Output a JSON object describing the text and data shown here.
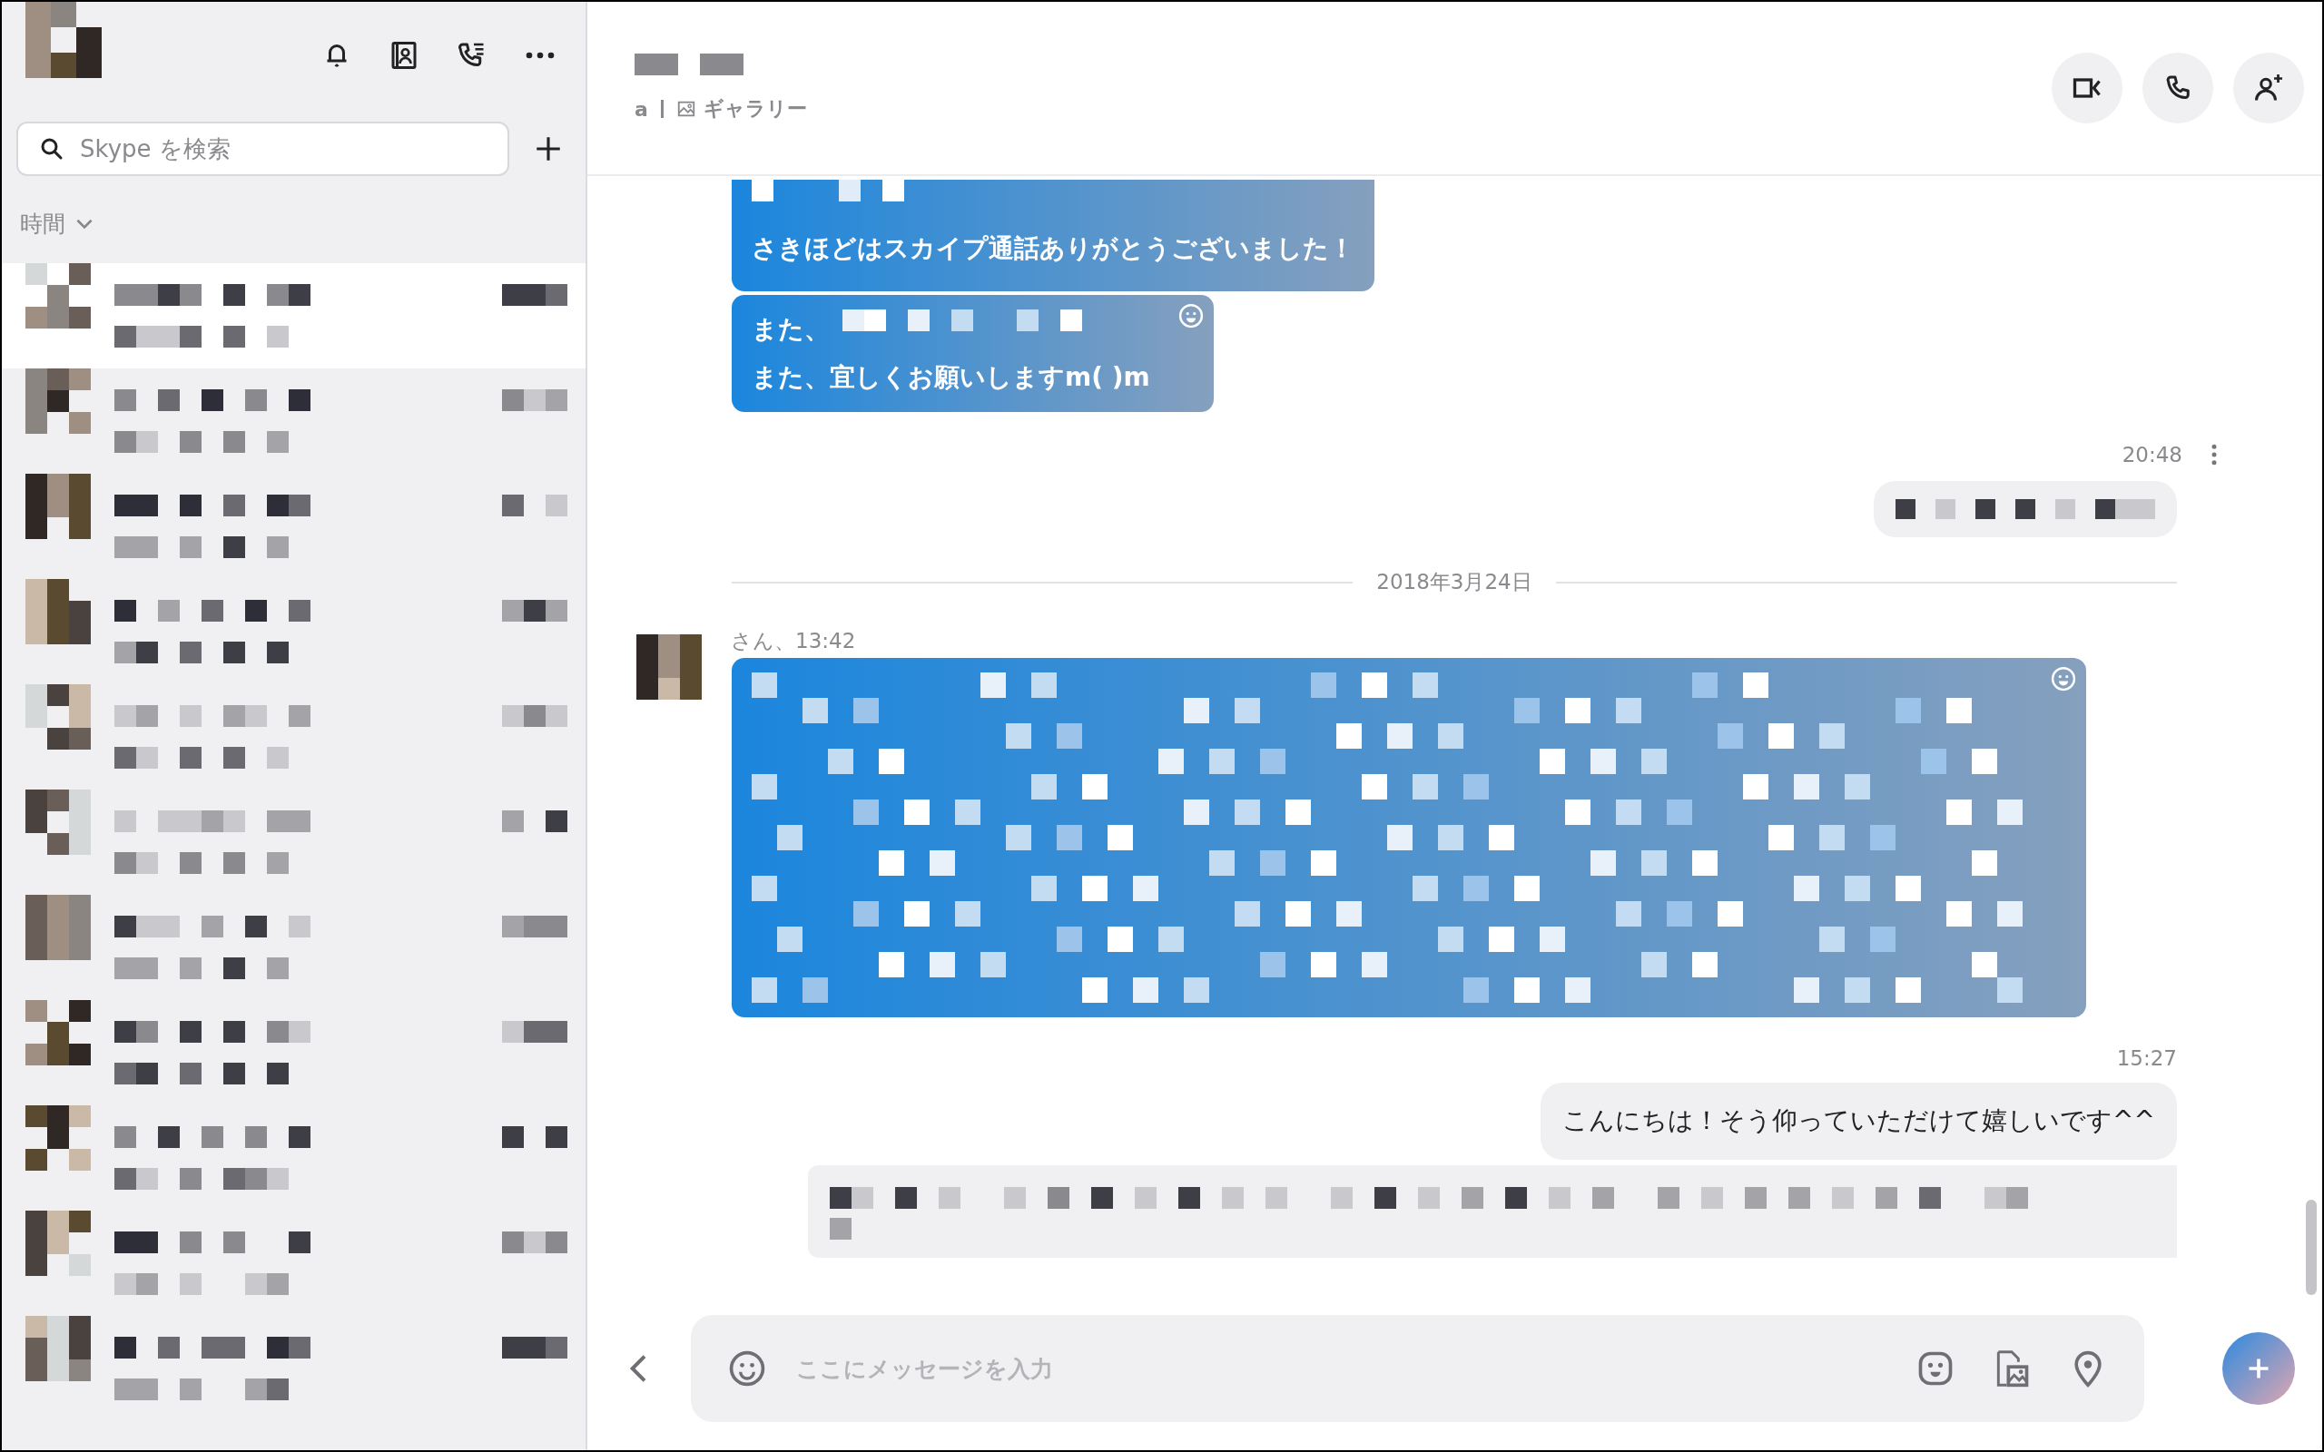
{
  "sidebar": {
    "search": {
      "placeholder": "Skype を検索"
    },
    "sort_label": "時間",
    "chats": [
      {
        "selected": true
      },
      {
        "selected": false
      },
      {
        "selected": false
      },
      {
        "selected": false
      },
      {
        "selected": false
      },
      {
        "selected": false
      },
      {
        "selected": false
      },
      {
        "selected": false
      },
      {
        "selected": false
      },
      {
        "selected": false
      },
      {
        "selected": false
      }
    ]
  },
  "chat": {
    "header": {
      "links": [
        "a",
        "ギャラリー"
      ]
    },
    "messages": [
      {
        "kind": "received",
        "redacted": true,
        "reaction": false,
        "lines": [
          {
            "text": "さきほどはスカイプ通話ありがとうございました！",
            "redacted": false
          }
        ]
      },
      {
        "kind": "received",
        "redacted": false,
        "reaction": true,
        "lines": [
          {
            "text": "また、",
            "redacted": true
          },
          {
            "text": "また、宜しくお願いしますm( )m",
            "redacted": false
          }
        ]
      },
      {
        "kind": "time",
        "text": "20:48",
        "menu": true
      },
      {
        "kind": "sent",
        "redacted": true,
        "reaction": false
      },
      {
        "kind": "date",
        "text": "2018年3月24日"
      },
      {
        "kind": "sender",
        "text": "さん、13:42"
      },
      {
        "kind": "received",
        "redacted": true,
        "reaction": true
      },
      {
        "kind": "time",
        "text": "15:27",
        "menu": false
      },
      {
        "kind": "sent",
        "redacted": false,
        "reaction": false,
        "lines": [
          {
            "text": "こんにちは！そう仰っていただけて嬉しいです^^",
            "redacted": false
          }
        ]
      },
      {
        "kind": "card"
      }
    ],
    "composer": {
      "placeholder": "ここにメッセージを入力"
    }
  }
}
